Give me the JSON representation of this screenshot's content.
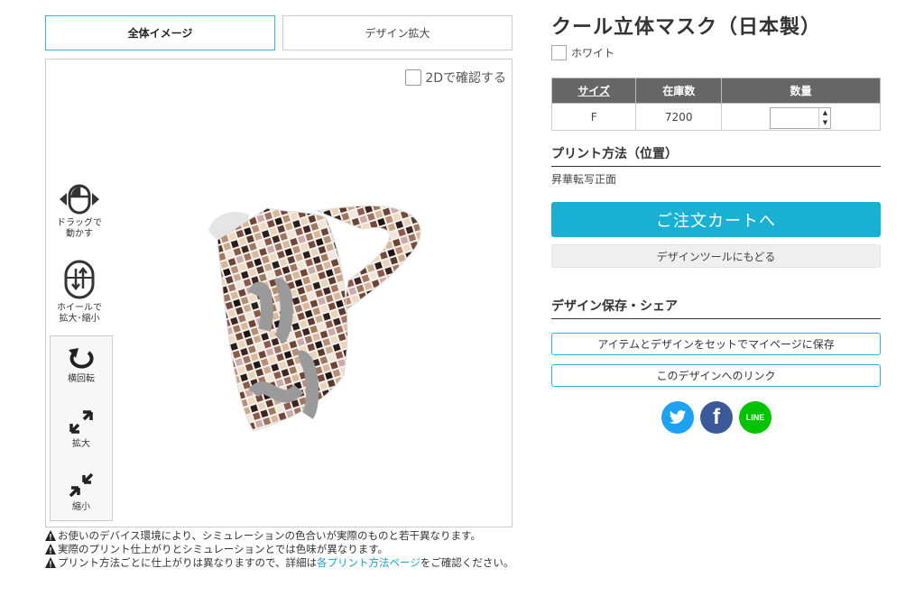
{
  "tabs": [
    {
      "label": "全体イメージ",
      "active": true
    },
    {
      "label": "デザイン拡大",
      "active": false
    }
  ],
  "viewer": {
    "check2d_label": "2Dで確認する",
    "controls": {
      "drag_label_1": "ドラッグで",
      "drag_label_2": "動かす",
      "wheel_label_1": "ホイールで",
      "wheel_label_2": "拡大･縮小",
      "rotate_label": "横回転",
      "zoom_in_label": "拡大",
      "zoom_out_label": "縮小"
    }
  },
  "notes": [
    "お使いのデバイス環境により、シミュレーションの色合いが実際のものと若干異なります。",
    "実際のプリント仕上がりとシミュレーションとでは色味が異なります。"
  ],
  "note3": {
    "before": "プリント方法ごとに仕上がりは異なりますので、詳細は",
    "link": "各プリント方法ページ",
    "after": "をご確認ください。"
  },
  "product": {
    "title": "クール立体マスク（日本製）",
    "color_name": "ホワイト",
    "color_hex": "#ffffff"
  },
  "stock_table": {
    "headers": [
      "サイズ",
      "在庫数",
      "数量"
    ],
    "rows": [
      {
        "size": "F",
        "stock": "7200",
        "qty": ""
      }
    ]
  },
  "print_method": {
    "title": "プリント方法（位置）",
    "value": "昇華転写正面"
  },
  "buttons": {
    "cart": "ご注文カートへ",
    "back_to_tool": "デザインツールにもどる",
    "save_mypage": "アイテムとデザインをセットでマイページに保存",
    "design_link": "このデザインへのリンク"
  },
  "share": {
    "title": "デザイン保存・シェア",
    "twitter_color": "#1da1f2",
    "facebook_color": "#3b5998",
    "line_color": "#00c300",
    "line_text": "LINE"
  },
  "colors": {
    "accent": "#1ab0d4",
    "table_header": "#666666"
  }
}
